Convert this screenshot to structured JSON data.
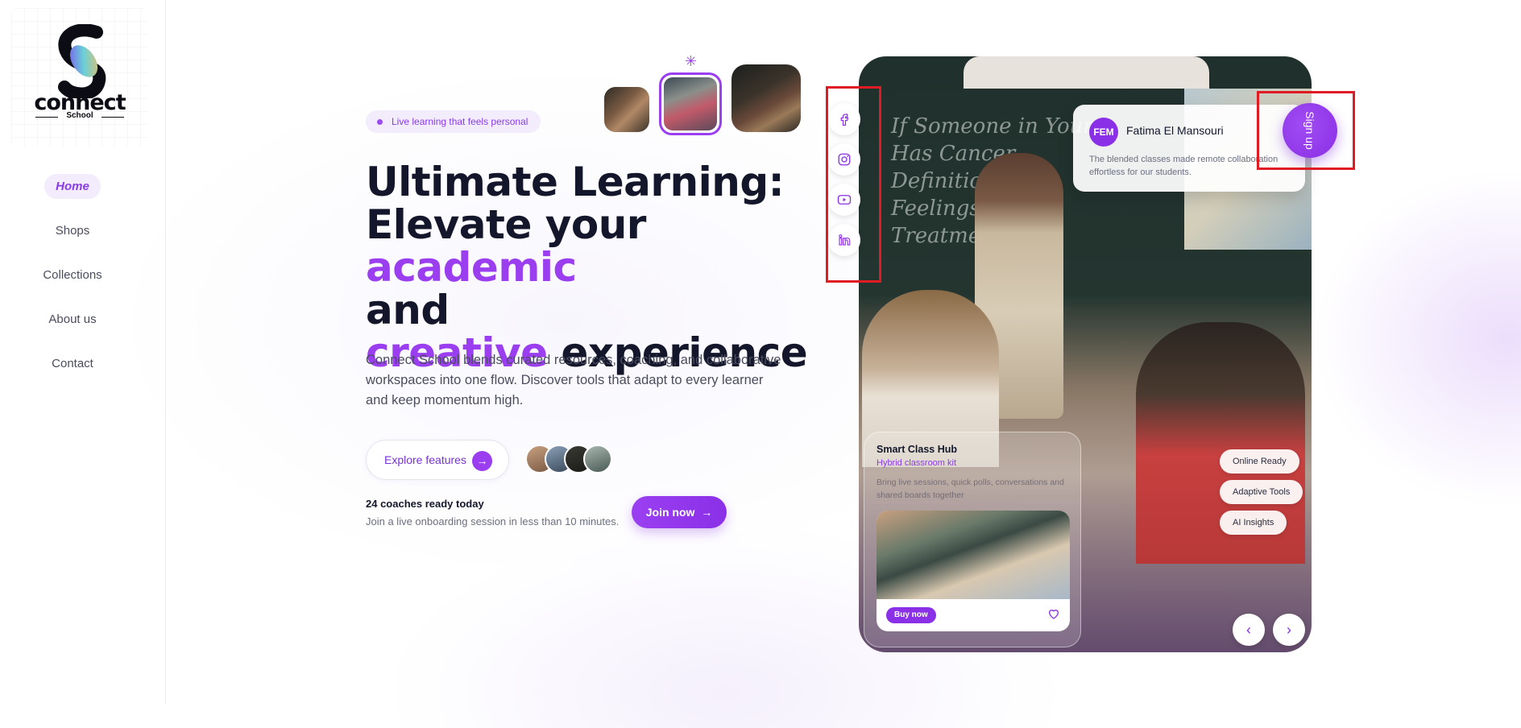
{
  "brand": {
    "name": "connect",
    "sub": "School"
  },
  "nav": {
    "items": [
      {
        "label": "Home",
        "active": true
      },
      {
        "label": "Shops"
      },
      {
        "label": "Collections"
      },
      {
        "label": "About us"
      },
      {
        "label": "Contact"
      }
    ]
  },
  "hero": {
    "pill": "Live learning that feels personal",
    "headline": {
      "line1": "Ultimate Learning:",
      "line2_a": "Elevate your ",
      "line2_b": "academic",
      "line3": "and",
      "line4_a": "creative",
      "line4_b": " experience"
    },
    "description": "Connect School blends curated resources, coaching, and collaborative workspaces into one flow. Discover tools that adapt to every learner and keep momentum high.",
    "explore_label": "Explore features",
    "coaches_title": "24 coaches ready today",
    "coaches_sub": "Join a live onboarding session in less than 10 minutes.",
    "join_label": "Join now"
  },
  "testimonial": {
    "initials": "FEM",
    "name": "Fatima El Mansouri",
    "quote": "The blended classes made remote collaboration effortless for our students."
  },
  "signup_label": "Sign up",
  "features": [
    "Online Ready",
    "Adaptive Tools",
    "AI Insights"
  ],
  "hub": {
    "title": "Smart Class Hub",
    "subtitle": "Hybrid classroom kit",
    "description": "Bring live sessions, quick polls, conversations and shared boards together",
    "buy_label": "Buy now"
  },
  "chalkboard": [
    "If Someone in Your",
    "Has Cancer",
    "Definitions",
    "Feelings",
    "Treatment"
  ],
  "colors": {
    "accent": "#9a3ef0",
    "highlight": "#e01b24"
  },
  "icons": {
    "socials": [
      "facebook-icon",
      "instagram-icon",
      "youtube-icon",
      "linkedin-icon"
    ]
  }
}
